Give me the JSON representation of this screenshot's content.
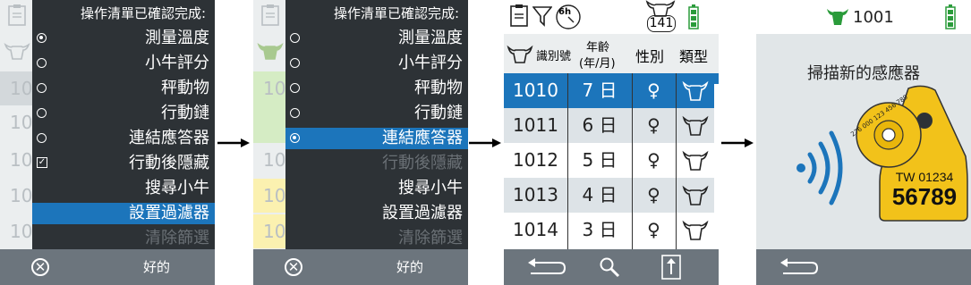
{
  "colors": {
    "accent": "#1c75bb",
    "menu_bg": "#2d3236",
    "footer_bg": "#6c757d",
    "battery": "#2a9b3a",
    "tag": "#f2c21a"
  },
  "screen1": {
    "title": "操作清單已確認完成:",
    "bg_rows": [
      "10",
      "10",
      "10",
      "10",
      "10",
      "10"
    ],
    "items": [
      {
        "label": "測量溫度",
        "control": "radio-on"
      },
      {
        "label": "小牛評分",
        "control": "radio"
      },
      {
        "label": "秤動物",
        "control": "radio"
      },
      {
        "label": "行動鏈",
        "control": "radio"
      },
      {
        "label": "連結應答器",
        "control": "radio"
      },
      {
        "label": "行動後隱藏",
        "control": "checkbox"
      },
      {
        "label": "搜尋小牛",
        "control": "none"
      },
      {
        "label": "設置過濾器",
        "control": "none",
        "selected": true
      },
      {
        "label": "清除篩選",
        "control": "none",
        "disabled": true
      }
    ],
    "footer": {
      "cancel_icon": "cancel-circle-icon",
      "ok_label": "好的"
    }
  },
  "screen2": {
    "title": "操作清單已確認完成:",
    "bg_rows": [
      "10",
      "10",
      "10",
      "10",
      "10",
      "10"
    ],
    "items": [
      {
        "label": "測量溫度",
        "control": "radio"
      },
      {
        "label": "小牛評分",
        "control": "radio"
      },
      {
        "label": "秤動物",
        "control": "radio"
      },
      {
        "label": "行動鏈",
        "control": "radio"
      },
      {
        "label": "連結應答器",
        "control": "radio-on",
        "selected": true
      },
      {
        "label": "行動後隱藏",
        "control": "none",
        "disabled": true
      },
      {
        "label": "搜尋小牛",
        "control": "none"
      },
      {
        "label": "設置過濾器",
        "control": "none"
      },
      {
        "label": "清除篩選",
        "control": "none",
        "disabled": true
      }
    ],
    "footer": {
      "cancel_icon": "cancel-circle-icon",
      "ok_label": "好的"
    }
  },
  "screen3": {
    "status": {
      "filter_badge": "6h",
      "count": "141"
    },
    "headers": {
      "id": "識別號",
      "age_line1": "年齡",
      "age_line2": "(年/月)",
      "sex": "性別",
      "type": "類型"
    },
    "rows": [
      {
        "id": "1010",
        "age": "7 日",
        "sex": "♀"
      },
      {
        "id": "1011",
        "age": "6 日",
        "sex": "♀"
      },
      {
        "id": "1012",
        "age": "5 日",
        "sex": "♀"
      },
      {
        "id": "1013",
        "age": "4 日",
        "sex": "♀"
      },
      {
        "id": "1014",
        "age": "3 日",
        "sex": "♀"
      }
    ]
  },
  "screen4": {
    "animal_id": "1001",
    "message": "掃描新的感應器",
    "tag_line1": "TW 01234",
    "tag_line2": "56789",
    "button_tag_text": "276 000 123 456 789"
  }
}
